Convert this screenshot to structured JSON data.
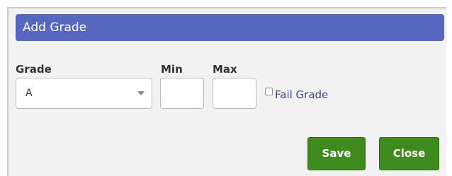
{
  "dialog": {
    "title": "Add Grade"
  },
  "form": {
    "grade_label": "Grade",
    "grade_value": "A",
    "min_label": "Min",
    "min_value": "",
    "max_label": "Max",
    "max_value": "",
    "fail_grade_label": "Fail Grade",
    "fail_grade_checked": false
  },
  "buttons": {
    "save_label": "Save",
    "close_label": "Close"
  },
  "colors": {
    "title_bar": "#5767c0",
    "button": "#3f8a1c",
    "dialog_bg": "#f2f2f2",
    "fail_label": "#3b4a80"
  }
}
